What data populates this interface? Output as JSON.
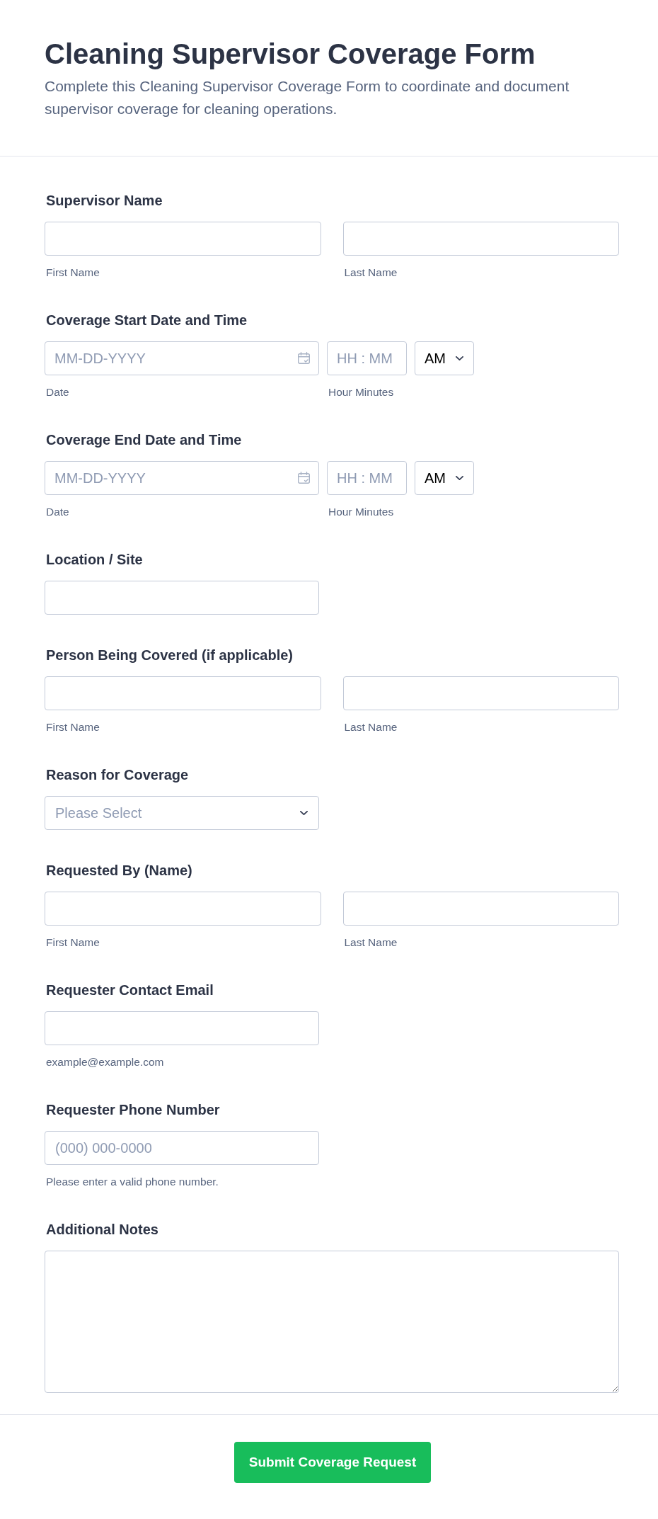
{
  "header": {
    "title": "Cleaning Supervisor Coverage Form",
    "description": "Complete this Cleaning Supervisor Coverage Form to coordinate and document supervisor coverage for cleaning operations."
  },
  "fields": [
    {
      "kind": "name",
      "label": "Supervisor Name",
      "parts": [
        {
          "sublabel": "First Name"
        },
        {
          "sublabel": "Last Name"
        }
      ]
    },
    {
      "kind": "datetime",
      "label": "Coverage Start Date and Time",
      "date": {
        "placeholder": "MM-DD-YYYY",
        "sublabel": "Date"
      },
      "time": {
        "placeholder": "HH : MM",
        "sublabel": "Hour Minutes"
      },
      "period": {
        "value": "AM"
      }
    },
    {
      "kind": "datetime",
      "label": "Coverage End Date and Time",
      "date": {
        "placeholder": "MM-DD-YYYY",
        "sublabel": "Date"
      },
      "time": {
        "placeholder": "HH : MM",
        "sublabel": "Hour Minutes"
      },
      "period": {
        "value": "AM"
      }
    },
    {
      "kind": "text",
      "label": "Location / Site"
    },
    {
      "kind": "name",
      "label": "Person Being Covered (if applicable)",
      "parts": [
        {
          "sublabel": "First Name"
        },
        {
          "sublabel": "Last Name"
        }
      ]
    },
    {
      "kind": "select",
      "label": "Reason for Coverage",
      "placeholder": "Please Select"
    },
    {
      "kind": "name",
      "label": "Requested By (Name)",
      "parts": [
        {
          "sublabel": "First Name"
        },
        {
          "sublabel": "Last Name"
        }
      ]
    },
    {
      "kind": "text",
      "label": "Requester Contact Email",
      "sublabel": "example@example.com"
    },
    {
      "kind": "text",
      "label": "Requester Phone Number",
      "placeholder": "(000) 000-0000",
      "sublabel": "Please enter a valid phone number."
    },
    {
      "kind": "textarea",
      "label": "Additional Notes"
    }
  ],
  "submit": {
    "label": "Submit Coverage Request"
  }
}
